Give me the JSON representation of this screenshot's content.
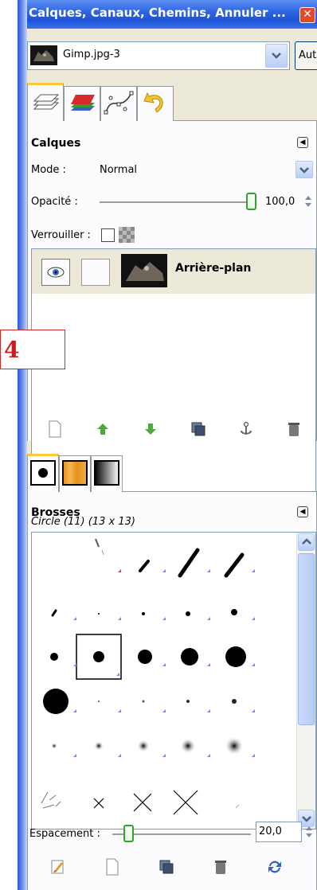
{
  "window": {
    "title": "Calques, Canaux, Chemins, Annuler ...",
    "close_icon": "close-icon"
  },
  "image_selector": {
    "value": "Gimp.jpg-3",
    "auto_label": "Auto"
  },
  "dock_tabs": [
    {
      "name": "layers-tab",
      "icon": "layers-icon",
      "active": true
    },
    {
      "name": "channels-tab",
      "icon": "channels-icon",
      "active": false
    },
    {
      "name": "paths-tab",
      "icon": "paths-icon",
      "active": false
    },
    {
      "name": "undo-tab",
      "icon": "undo-icon",
      "active": false
    }
  ],
  "layers": {
    "title": "Calques",
    "mode_label": "Mode :",
    "mode_value": "Normal",
    "opacity_label": "Opacité :",
    "opacity_value": "100,0",
    "opacity_fraction": 1.0,
    "lock_label": "Verrouiller :",
    "items": [
      {
        "name": "Arrière-plan",
        "visible": true
      }
    ],
    "buttons": [
      "new-layer-icon",
      "raise-layer-icon",
      "lower-layer-icon",
      "duplicate-layer-icon",
      "anchor-layer-icon",
      "delete-layer-icon"
    ]
  },
  "step_marker": "4",
  "brush_tabs": [
    {
      "name": "brushes-tab",
      "icon": "brush-icon",
      "active": true
    },
    {
      "name": "patterns-tab",
      "icon": "pattern-icon",
      "active": false
    },
    {
      "name": "gradients-tab",
      "icon": "gradient-icon",
      "active": false
    }
  ],
  "brushes": {
    "title": "Brosses",
    "selected": "Circle (11) (13 x 13)",
    "spacing_label": "Espacement :",
    "spacing_value": "20,0",
    "spacing_fraction": 0.2,
    "buttons": [
      "edit-brush-icon",
      "new-brush-icon",
      "duplicate-brush-icon",
      "delete-brush-icon",
      "refresh-brushes-icon"
    ]
  },
  "colors": {
    "titlebar": "#1d53d6",
    "panel_bg": "#ece9d8",
    "accent_tab": "#ffc83c",
    "slider_green": "#2fa52b",
    "marker_red": "#d11a1a"
  }
}
